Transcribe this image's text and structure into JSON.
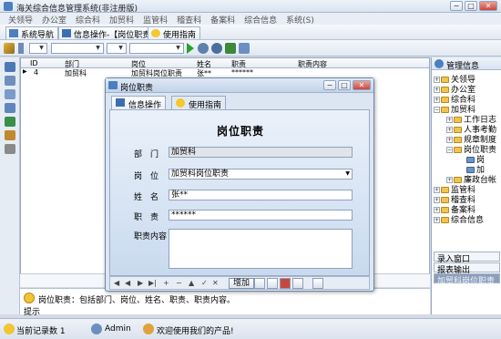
{
  "window": {
    "title": "海关综合信息管理系统(非注册版)",
    "min": "−",
    "max": "□",
    "close": "✕"
  },
  "menu": [
    "关领导",
    "办公室",
    "综合科",
    "加贸科",
    "监管科",
    "稽查科",
    "备案科",
    "综合信息",
    "系统(S)"
  ],
  "tabs": [
    {
      "label": "系统导航"
    },
    {
      "label": "信息操作-【岗位职责】"
    },
    {
      "label": "使用指南"
    }
  ],
  "toolbar": {
    "combo1_value": "",
    "combo2_value": "",
    "combo3_value": ""
  },
  "grid": {
    "headers": [
      "ID",
      "部门",
      "岗位",
      "姓名",
      "职责",
      "职责内容"
    ],
    "rows": [
      {
        "id": "4",
        "dept": "加贸科",
        "post": "加贸科岗位职责",
        "name": "张**",
        "duty": "******",
        "content": ""
      }
    ],
    "row_marker": "▶"
  },
  "right_panel": {
    "title": "管理信息",
    "tree": [
      {
        "label": "关领导",
        "level": 0,
        "expander": "+"
      },
      {
        "label": "办公室",
        "level": 0,
        "expander": "+"
      },
      {
        "label": "综合科",
        "level": 0,
        "expander": "+"
      },
      {
        "label": "加贸科",
        "level": 0,
        "expander": "−"
      },
      {
        "label": "工作日志",
        "level": 1,
        "expander": "+"
      },
      {
        "label": "人事考勤",
        "level": 1,
        "expander": "+"
      },
      {
        "label": "规章制度",
        "level": 1,
        "expander": "+"
      },
      {
        "label": "岗位职责",
        "level": 1,
        "expander": "−"
      },
      {
        "label": "岗",
        "level": 2,
        "expander": ""
      },
      {
        "label": "加",
        "level": 2,
        "expander": ""
      },
      {
        "label": "廉政台帐",
        "level": 1,
        "expander": "+"
      },
      {
        "label": "监管科",
        "level": 0,
        "expander": "+"
      },
      {
        "label": "稽查科",
        "level": 0,
        "expander": "+"
      },
      {
        "label": "备案科",
        "level": 0,
        "expander": "+"
      },
      {
        "label": "综合信息",
        "level": 0,
        "expander": "+"
      }
    ],
    "buttons": [
      "录入窗口",
      "报表输出",
      "加贸科岗位职责"
    ]
  },
  "tip": {
    "text": "岗位职责：包括部门、岗位、姓名、职责、职责内容。",
    "label": "提示"
  },
  "status": {
    "record_count": "当前记录数 1",
    "user": "Admin",
    "welcome": "欢迎使用我们的产品!"
  },
  "dialog": {
    "title": "岗位职责",
    "tabs": [
      {
        "label": "信息操作"
      },
      {
        "label": "使用指南"
      }
    ],
    "heading": "岗位职责",
    "fields": {
      "dept_label": "部　门",
      "dept_value": "加贸科",
      "post_label": "岗　位",
      "post_value": "加贸科岗位职责",
      "name_label": "姓　名",
      "name_value": "张**",
      "duty_label": "职　责",
      "duty_value": "******",
      "content_label": "职责内容",
      "content_value": ""
    },
    "nav": [
      "◀",
      "◀",
      "▶",
      "▶|",
      "+",
      "−",
      "▲",
      "✓",
      "✕"
    ],
    "add_button": "增加",
    "colors": {
      "title_bg": "#c3d3e8",
      "body_bg": "#c9daee"
    }
  }
}
